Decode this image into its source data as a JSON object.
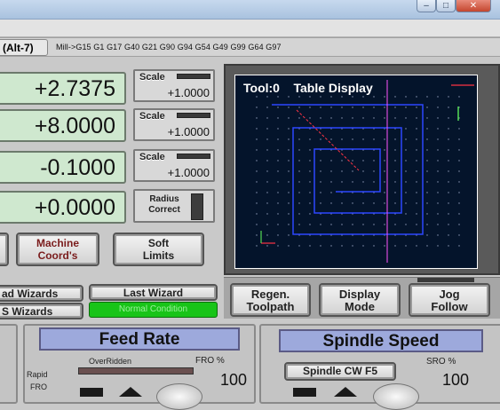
{
  "modebar": {
    "tab_label": "(Alt-7)",
    "gcodes": "Mill->G15  G1 G17 G40 G21 G90 G94 G54 G49 G99 G64 G97"
  },
  "dro": [
    {
      "value": "+2.7375",
      "scale_label": "Scale",
      "scale_value": "+1.0000"
    },
    {
      "value": "+8.0000",
      "scale_label": "Scale",
      "scale_value": "+1.0000"
    },
    {
      "value": "-0.1000",
      "scale_label": "Scale",
      "scale_value": "+1.0000"
    },
    {
      "value": "+0.0000"
    }
  ],
  "radius_correct": "Radius Correct",
  "buttons": {
    "machine_coords": "Machine Coord's",
    "soft_limits": "Soft Limits",
    "regen_toolpath": "Regen. Toolpath",
    "display_mode": "Display Mode",
    "jog_follow": "Jog Follow",
    "load_wizards": "ad Wizards",
    "last_wizard": "Last Wizard",
    "nfs_wizards": "S Wizards",
    "spindle_cw": "Spindle CW F5"
  },
  "toolpath": {
    "title": "Tool:0    Table Display",
    "colors": {
      "background": "#04142b",
      "path": "#2d46ff",
      "frame": "#ffffff",
      "accent": "#ff3344"
    }
  },
  "status": {
    "normal_condition": "Normal Condition",
    "color": "#18c418"
  },
  "feed": {
    "title": "Feed Rate",
    "overridden": "OverRidden",
    "fro_label": "FRO %",
    "fro_value": "100",
    "rapid_label": "Rapid",
    "rapid_fro": "FRO"
  },
  "spindle": {
    "title": "Spindle Speed",
    "sro_label": "SRO %",
    "sro_value": "100"
  }
}
